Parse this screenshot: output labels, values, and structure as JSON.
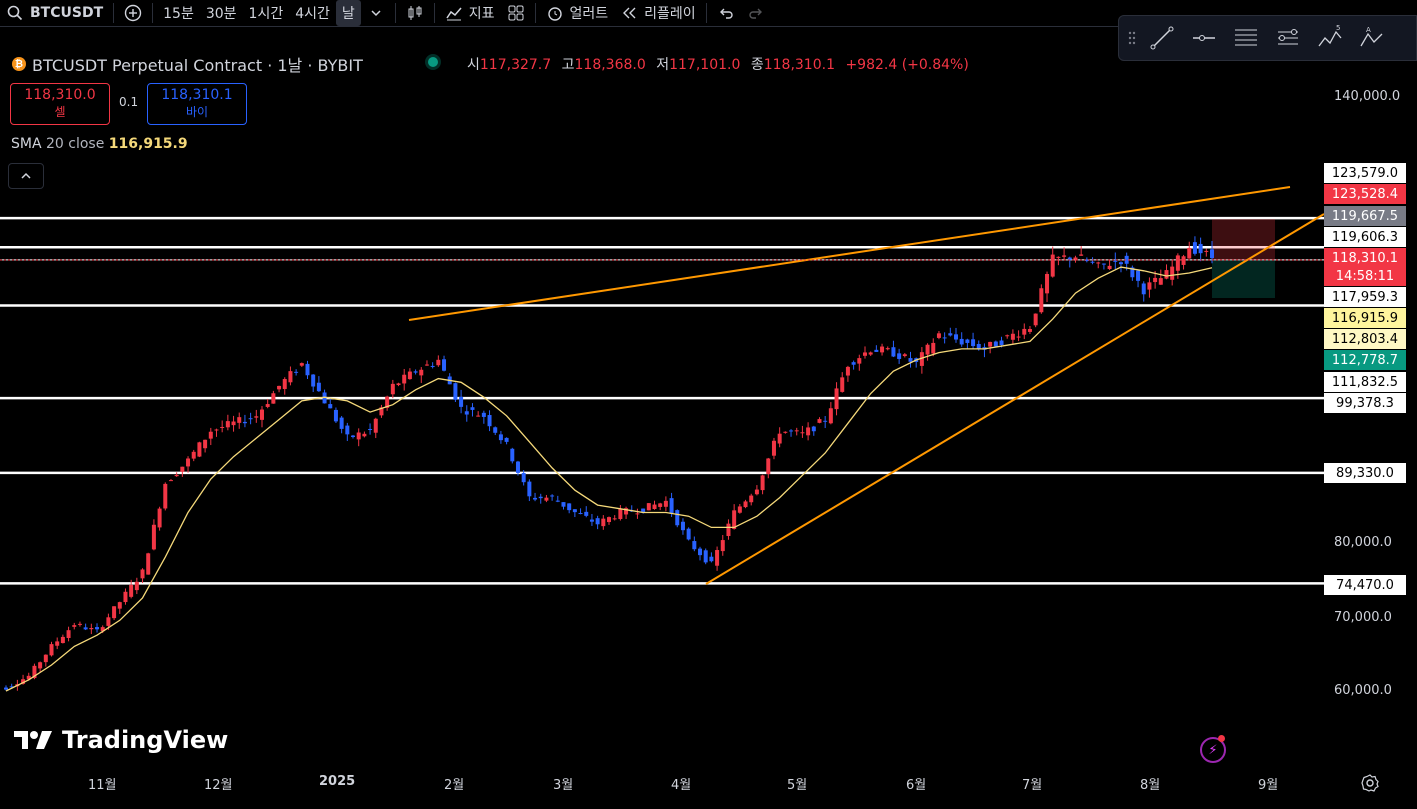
{
  "toolbar": {
    "symbol": "BTCUSDT",
    "intervals": [
      "15분",
      "30분",
      "1시간",
      "4시간",
      "날"
    ],
    "indicators": "지표",
    "alerts": "얼러트",
    "replay": "리플레이"
  },
  "legend": {
    "title": "BTCUSDT Perpetual Contract · 1날 · BYBIT",
    "open_label": "시",
    "open": "117,327.7",
    "high_label": "고",
    "high": "118,368.0",
    "low_label": "저",
    "low": "117,101.0",
    "close_label": "종",
    "close": "118,310.1",
    "change": "+982.4 (+0.84%)"
  },
  "trade": {
    "sell_price": "118,310.0",
    "sell_label": "셀",
    "spread": "0.1",
    "buy_price": "118,310.1",
    "buy_label": "바이"
  },
  "sma": {
    "label": "SMA",
    "params": "20 close",
    "value": "116,915.9"
  },
  "drawing_toolbar": {
    "items": [
      "trend-line-icon",
      "horizontal-ray-icon",
      "parallel-channel-icon",
      "fib-icon",
      "pattern-icon",
      "elliott-icon"
    ],
    "elliott_marks": "1 5",
    "abc_marks": "A"
  },
  "price_axis": {
    "labels": [
      "140,000.0",
      "80,000.0",
      "70,000.0",
      "60,000.0"
    ],
    "tags": [
      {
        "text": "123,579.0",
        "style": "white"
      },
      {
        "text": "123,528.4",
        "style": "red"
      },
      {
        "text": "119,667.5",
        "style": "gray"
      },
      {
        "text": "119,606.3",
        "style": "white"
      },
      {
        "text": "118,310.1",
        "style": "red"
      },
      {
        "text": "14:58:11",
        "style": "red"
      },
      {
        "text": "117,959.3",
        "style": "white"
      },
      {
        "text": "116,915.9",
        "style": "yellow"
      },
      {
        "text": "112,803.4",
        "style": "lyellow"
      },
      {
        "text": "112,778.7",
        "style": "green"
      },
      {
        "text": "111,832.5",
        "style": "white"
      },
      {
        "text": "99,378.3",
        "style": "white"
      },
      {
        "text": "89,330.0",
        "style": "white"
      },
      {
        "text": "74,470.0",
        "style": "white"
      }
    ]
  },
  "time_axis": [
    "11월",
    "12월",
    "2025",
    "2월",
    "3월",
    "4월",
    "5월",
    "6월",
    "7월",
    "8월",
    "9월"
  ],
  "branding": "TradingView",
  "colors": {
    "up": "#f23645",
    "down": "#2962ff",
    "sma": "#f5d97a",
    "trend": "#ff9800"
  },
  "chart_data": {
    "type": "candlestick",
    "series": [
      {
        "name": "BTCUSDT",
        "close": [
          60500,
          62000,
          66000,
          69000,
          68000,
          72000,
          76000,
          88000,
          91000,
          95000,
          96000,
          97000,
          101000,
          104000,
          99000,
          94000,
          95000,
          101000,
          103000,
          104500,
          98000,
          97000,
          93000,
          86000,
          86000,
          84000,
          82500,
          84000,
          84500,
          85500,
          80000,
          77000,
          84000,
          87500,
          95000,
          94500,
          96500,
          104000,
          106000,
          105500,
          104000,
          108000,
          107000,
          106000,
          107500,
          109000,
          118000,
          118500,
          117000,
          118000,
          114000,
          116000,
          119800,
          118310
        ]
      },
      {
        "name": "SMA 20 close",
        "values": [
          60000,
          61500,
          63500,
          66000,
          67500,
          69500,
          72500,
          78000,
          84000,
          88500,
          91500,
          94000,
          96500,
          99000,
          99500,
          99000,
          97500,
          98500,
          100500,
          102000,
          101500,
          99500,
          97000,
          93500,
          90000,
          87000,
          85000,
          84500,
          84000,
          84000,
          83500,
          82000,
          82000,
          83500,
          86000,
          89000,
          92000,
          96000,
          100000,
          103000,
          104500,
          105500,
          106000,
          106000,
          106500,
          107000,
          110000,
          113500,
          115500,
          117000,
          116500,
          115800,
          116200,
          116915.9
        ]
      }
    ],
    "levels": [
      123579.0,
      119667.5,
      119606.3,
      117959.3,
      111832.5,
      99378.3,
      89330.0,
      74470.0
    ],
    "ylim": [
      55000,
      145000
    ]
  }
}
